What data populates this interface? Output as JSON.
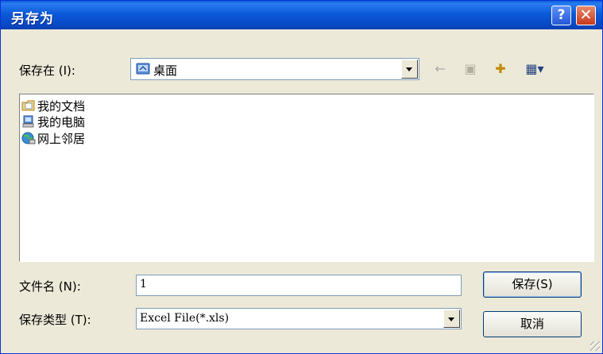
{
  "window": {
    "title": "另存为",
    "help_label": "?",
    "close_label": "✕"
  },
  "save_in": {
    "label": "保存在 (I):",
    "value": "桌面",
    "icon": "desktop-icon"
  },
  "toolbar": {
    "back_icon": "←",
    "up_icon": "▣",
    "new_folder_icon": "✚",
    "view_icon": "▦▾"
  },
  "file_list": {
    "items": [
      {
        "label": "我的文档",
        "icon": "my-documents-icon"
      },
      {
        "label": "我的电脑",
        "icon": "my-computer-icon"
      },
      {
        "label": "网上邻居",
        "icon": "network-places-icon"
      }
    ]
  },
  "filename": {
    "label": "文件名 (N):",
    "value": "1"
  },
  "filetype": {
    "label": "保存类型 (T):",
    "value": "Excel File(*.xls)"
  },
  "buttons": {
    "save": "保存(S)",
    "cancel": "取消"
  },
  "colors": {
    "title_bar": "#0a5fd8",
    "dialog_bg": "#ece9d8",
    "close_button": "#c8391a"
  }
}
